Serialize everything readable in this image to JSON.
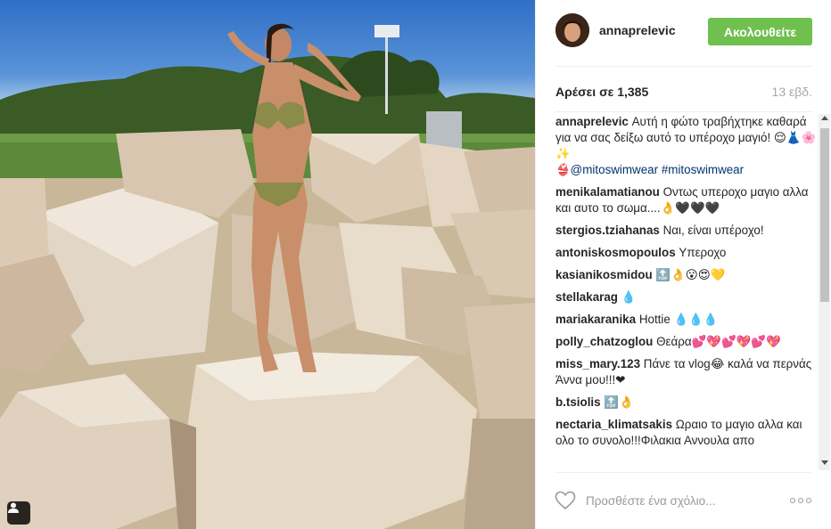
{
  "post": {
    "username": "annaprelevic",
    "follow_label": "Ακολουθείτε",
    "likes_prefix": "Αρέσει σε",
    "likes_count": "1,385",
    "age": "13 εβδ."
  },
  "comments": [
    {
      "author": "annaprelevic",
      "text": "Αυτή η φώτο τραβήχτηκε καθαρά για να σας δείξω αυτό το υπέροχο μαγιό! 😌👗🌸✨",
      "tag1": "👙@mitoswimwear",
      "tag2": "#mitoswimwear"
    },
    {
      "author": "menikalamatianou",
      "text": "Οντως υπεροχο μαγιο αλλα και αυτο το σωμα....👌🖤🖤🖤"
    },
    {
      "author": "stergios.tziahanas",
      "text": "Ναι, είναι υπέροχο!"
    },
    {
      "author": "antoniskosmopoulos",
      "text": "Υπεροχο"
    },
    {
      "author": "kasianikosmidou",
      "text": "🔝👌😮😍💛"
    },
    {
      "author": "stellakarag",
      "text": "💧"
    },
    {
      "author": "mariakaranika",
      "text": "Hottie 💧💧💧"
    },
    {
      "author": "polly_chatzoglou",
      "text": "Θεάρα💕💖💕💖💕💖"
    },
    {
      "author": "miss_mary.123",
      "text": "Πάνε τα vlog😂 καλά να περνάς Άννα μου!!!❤"
    },
    {
      "author": "b.tsiolis",
      "text": "🔝👌"
    },
    {
      "author": "nectaria_klimatsakis",
      "text": "Ωραιο το μαγιο αλλα και ολο το συνολο!!!Φιλακια Αννουλα απο"
    }
  ],
  "footer": {
    "comment_placeholder": "Προσθέστε ένα σχόλιο...",
    "heart_icon": "heart-outline-icon",
    "more_icon": "more-options-icon"
  },
  "colors": {
    "follow_button": "#70c050",
    "link": "#003569",
    "muted": "#a5a7aa"
  }
}
